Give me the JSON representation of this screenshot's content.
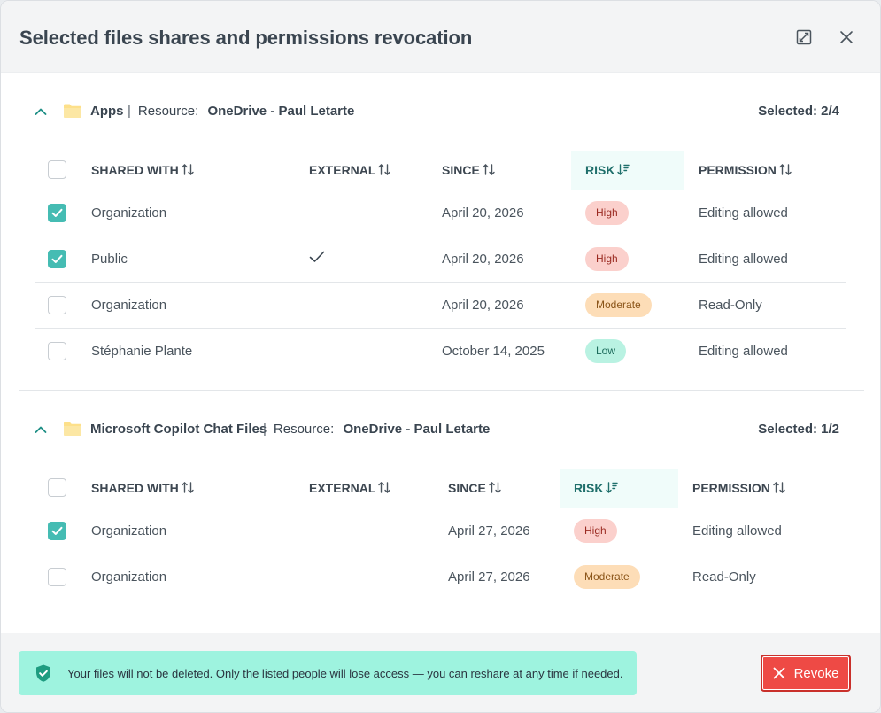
{
  "modal": {
    "title": "Selected files shares and permissions revocation"
  },
  "sections": [
    {
      "name": "Apps",
      "resource_label": "Resource:",
      "resource_value": "OneDrive - Paul Letarte",
      "selected": "Selected: 2/4",
      "columns": [
        "SHARED WITH",
        "EXTERNAL",
        "SINCE",
        "RISK",
        "PERMISSION"
      ],
      "rows": [
        {
          "checked": true,
          "shared_with": "Organization",
          "external": false,
          "since": "April 20, 2026",
          "risk": "High",
          "permission": "Editing allowed"
        },
        {
          "checked": true,
          "shared_with": "Public",
          "external": true,
          "since": "April 20, 2026",
          "risk": "High",
          "permission": "Editing allowed"
        },
        {
          "checked": false,
          "shared_with": "Organization",
          "external": false,
          "since": "April 20, 2026",
          "risk": "Moderate",
          "permission": "Read-Only"
        },
        {
          "checked": false,
          "shared_with": "Stéphanie Plante",
          "external": false,
          "since": "October 14, 2025",
          "risk": "Low",
          "permission": "Editing allowed"
        }
      ]
    },
    {
      "name": "Microsoft Copilot Chat Files",
      "resource_label": "Resource:",
      "resource_value": "OneDrive - Paul Letarte",
      "selected": "Selected: 1/2",
      "columns": [
        "SHARED WITH",
        "EXTERNAL",
        "SINCE",
        "RISK",
        "PERMISSION"
      ],
      "rows": [
        {
          "checked": true,
          "shared_with": "Organization",
          "external": false,
          "since": "April 27, 2026",
          "risk": "High",
          "permission": "Editing allowed"
        },
        {
          "checked": false,
          "shared_with": "Organization",
          "external": false,
          "since": "April 27, 2026",
          "risk": "Moderate",
          "permission": "Read-Only"
        }
      ]
    }
  ],
  "footer": {
    "notice": "Your files will not be deleted. Only the listed people will lose access — you can reshare at any time if needed.",
    "revoke_label": "Revoke"
  },
  "colors": {
    "accent": "#45bcb3",
    "danger": "#ee4a45",
    "notice_bg": "#9ef3df"
  }
}
